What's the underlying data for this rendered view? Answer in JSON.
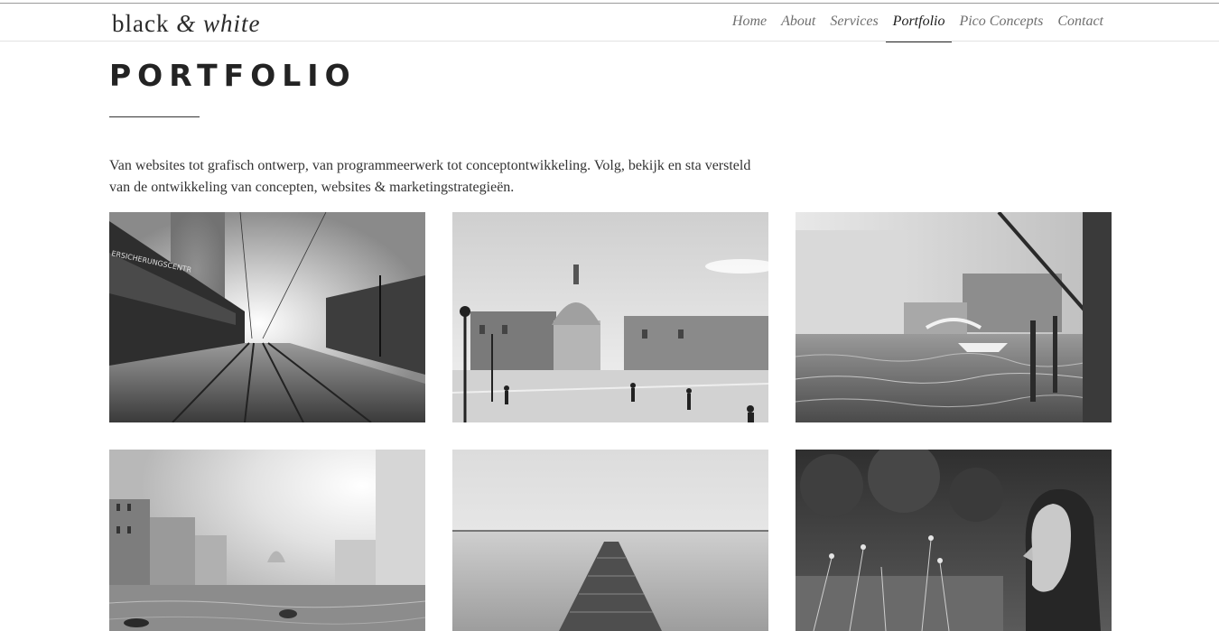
{
  "logo": {
    "part1": "black",
    "amp": "&",
    "part2": "white"
  },
  "nav": {
    "items": [
      {
        "label": "Home"
      },
      {
        "label": "About"
      },
      {
        "label": "Services"
      },
      {
        "label": "Portfolio",
        "active": true
      },
      {
        "label": "Pico Concepts"
      },
      {
        "label": "Contact"
      }
    ]
  },
  "page": {
    "title": "PORTFOLIO",
    "intro": "Van websites tot grafisch ontwerp, van programmeerwerk tot conceptontwikkeling. Volg, bekijk en sta versteld van de ontwikkeling van concepten, websites & marketingstrategieën."
  },
  "portfolio": {
    "items": [
      {
        "sign_text": "ERSICHERUNGSCENTR"
      },
      {},
      {},
      {},
      {},
      {}
    ]
  }
}
